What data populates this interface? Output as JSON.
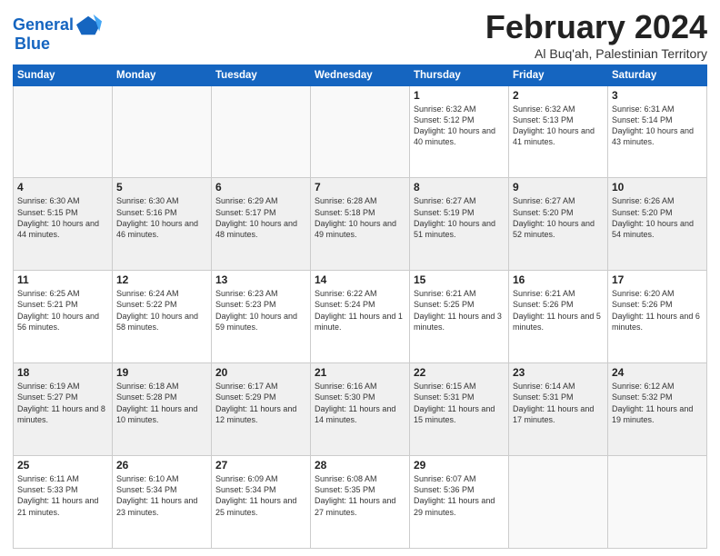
{
  "logo": {
    "line1": "General",
    "line2": "Blue"
  },
  "title": "February 2024",
  "subtitle": "Al Buq'ah, Palestinian Territory",
  "weekdays": [
    "Sunday",
    "Monday",
    "Tuesday",
    "Wednesday",
    "Thursday",
    "Friday",
    "Saturday"
  ],
  "rows": [
    [
      {
        "day": "",
        "info": ""
      },
      {
        "day": "",
        "info": ""
      },
      {
        "day": "",
        "info": ""
      },
      {
        "day": "",
        "info": ""
      },
      {
        "day": "1",
        "info": "Sunrise: 6:32 AM\nSunset: 5:12 PM\nDaylight: 10 hours\nand 40 minutes."
      },
      {
        "day": "2",
        "info": "Sunrise: 6:32 AM\nSunset: 5:13 PM\nDaylight: 10 hours\nand 41 minutes."
      },
      {
        "day": "3",
        "info": "Sunrise: 6:31 AM\nSunset: 5:14 PM\nDaylight: 10 hours\nand 43 minutes."
      }
    ],
    [
      {
        "day": "4",
        "info": "Sunrise: 6:30 AM\nSunset: 5:15 PM\nDaylight: 10 hours\nand 44 minutes."
      },
      {
        "day": "5",
        "info": "Sunrise: 6:30 AM\nSunset: 5:16 PM\nDaylight: 10 hours\nand 46 minutes."
      },
      {
        "day": "6",
        "info": "Sunrise: 6:29 AM\nSunset: 5:17 PM\nDaylight: 10 hours\nand 48 minutes."
      },
      {
        "day": "7",
        "info": "Sunrise: 6:28 AM\nSunset: 5:18 PM\nDaylight: 10 hours\nand 49 minutes."
      },
      {
        "day": "8",
        "info": "Sunrise: 6:27 AM\nSunset: 5:19 PM\nDaylight: 10 hours\nand 51 minutes."
      },
      {
        "day": "9",
        "info": "Sunrise: 6:27 AM\nSunset: 5:20 PM\nDaylight: 10 hours\nand 52 minutes."
      },
      {
        "day": "10",
        "info": "Sunrise: 6:26 AM\nSunset: 5:20 PM\nDaylight: 10 hours\nand 54 minutes."
      }
    ],
    [
      {
        "day": "11",
        "info": "Sunrise: 6:25 AM\nSunset: 5:21 PM\nDaylight: 10 hours\nand 56 minutes."
      },
      {
        "day": "12",
        "info": "Sunrise: 6:24 AM\nSunset: 5:22 PM\nDaylight: 10 hours\nand 58 minutes."
      },
      {
        "day": "13",
        "info": "Sunrise: 6:23 AM\nSunset: 5:23 PM\nDaylight: 10 hours\nand 59 minutes."
      },
      {
        "day": "14",
        "info": "Sunrise: 6:22 AM\nSunset: 5:24 PM\nDaylight: 11 hours\nand 1 minute."
      },
      {
        "day": "15",
        "info": "Sunrise: 6:21 AM\nSunset: 5:25 PM\nDaylight: 11 hours\nand 3 minutes."
      },
      {
        "day": "16",
        "info": "Sunrise: 6:21 AM\nSunset: 5:26 PM\nDaylight: 11 hours\nand 5 minutes."
      },
      {
        "day": "17",
        "info": "Sunrise: 6:20 AM\nSunset: 5:26 PM\nDaylight: 11 hours\nand 6 minutes."
      }
    ],
    [
      {
        "day": "18",
        "info": "Sunrise: 6:19 AM\nSunset: 5:27 PM\nDaylight: 11 hours\nand 8 minutes."
      },
      {
        "day": "19",
        "info": "Sunrise: 6:18 AM\nSunset: 5:28 PM\nDaylight: 11 hours\nand 10 minutes."
      },
      {
        "day": "20",
        "info": "Sunrise: 6:17 AM\nSunset: 5:29 PM\nDaylight: 11 hours\nand 12 minutes."
      },
      {
        "day": "21",
        "info": "Sunrise: 6:16 AM\nSunset: 5:30 PM\nDaylight: 11 hours\nand 14 minutes."
      },
      {
        "day": "22",
        "info": "Sunrise: 6:15 AM\nSunset: 5:31 PM\nDaylight: 11 hours\nand 15 minutes."
      },
      {
        "day": "23",
        "info": "Sunrise: 6:14 AM\nSunset: 5:31 PM\nDaylight: 11 hours\nand 17 minutes."
      },
      {
        "day": "24",
        "info": "Sunrise: 6:12 AM\nSunset: 5:32 PM\nDaylight: 11 hours\nand 19 minutes."
      }
    ],
    [
      {
        "day": "25",
        "info": "Sunrise: 6:11 AM\nSunset: 5:33 PM\nDaylight: 11 hours\nand 21 minutes."
      },
      {
        "day": "26",
        "info": "Sunrise: 6:10 AM\nSunset: 5:34 PM\nDaylight: 11 hours\nand 23 minutes."
      },
      {
        "day": "27",
        "info": "Sunrise: 6:09 AM\nSunset: 5:34 PM\nDaylight: 11 hours\nand 25 minutes."
      },
      {
        "day": "28",
        "info": "Sunrise: 6:08 AM\nSunset: 5:35 PM\nDaylight: 11 hours\nand 27 minutes."
      },
      {
        "day": "29",
        "info": "Sunrise: 6:07 AM\nSunset: 5:36 PM\nDaylight: 11 hours\nand 29 minutes."
      },
      {
        "day": "",
        "info": ""
      },
      {
        "day": "",
        "info": ""
      }
    ]
  ]
}
